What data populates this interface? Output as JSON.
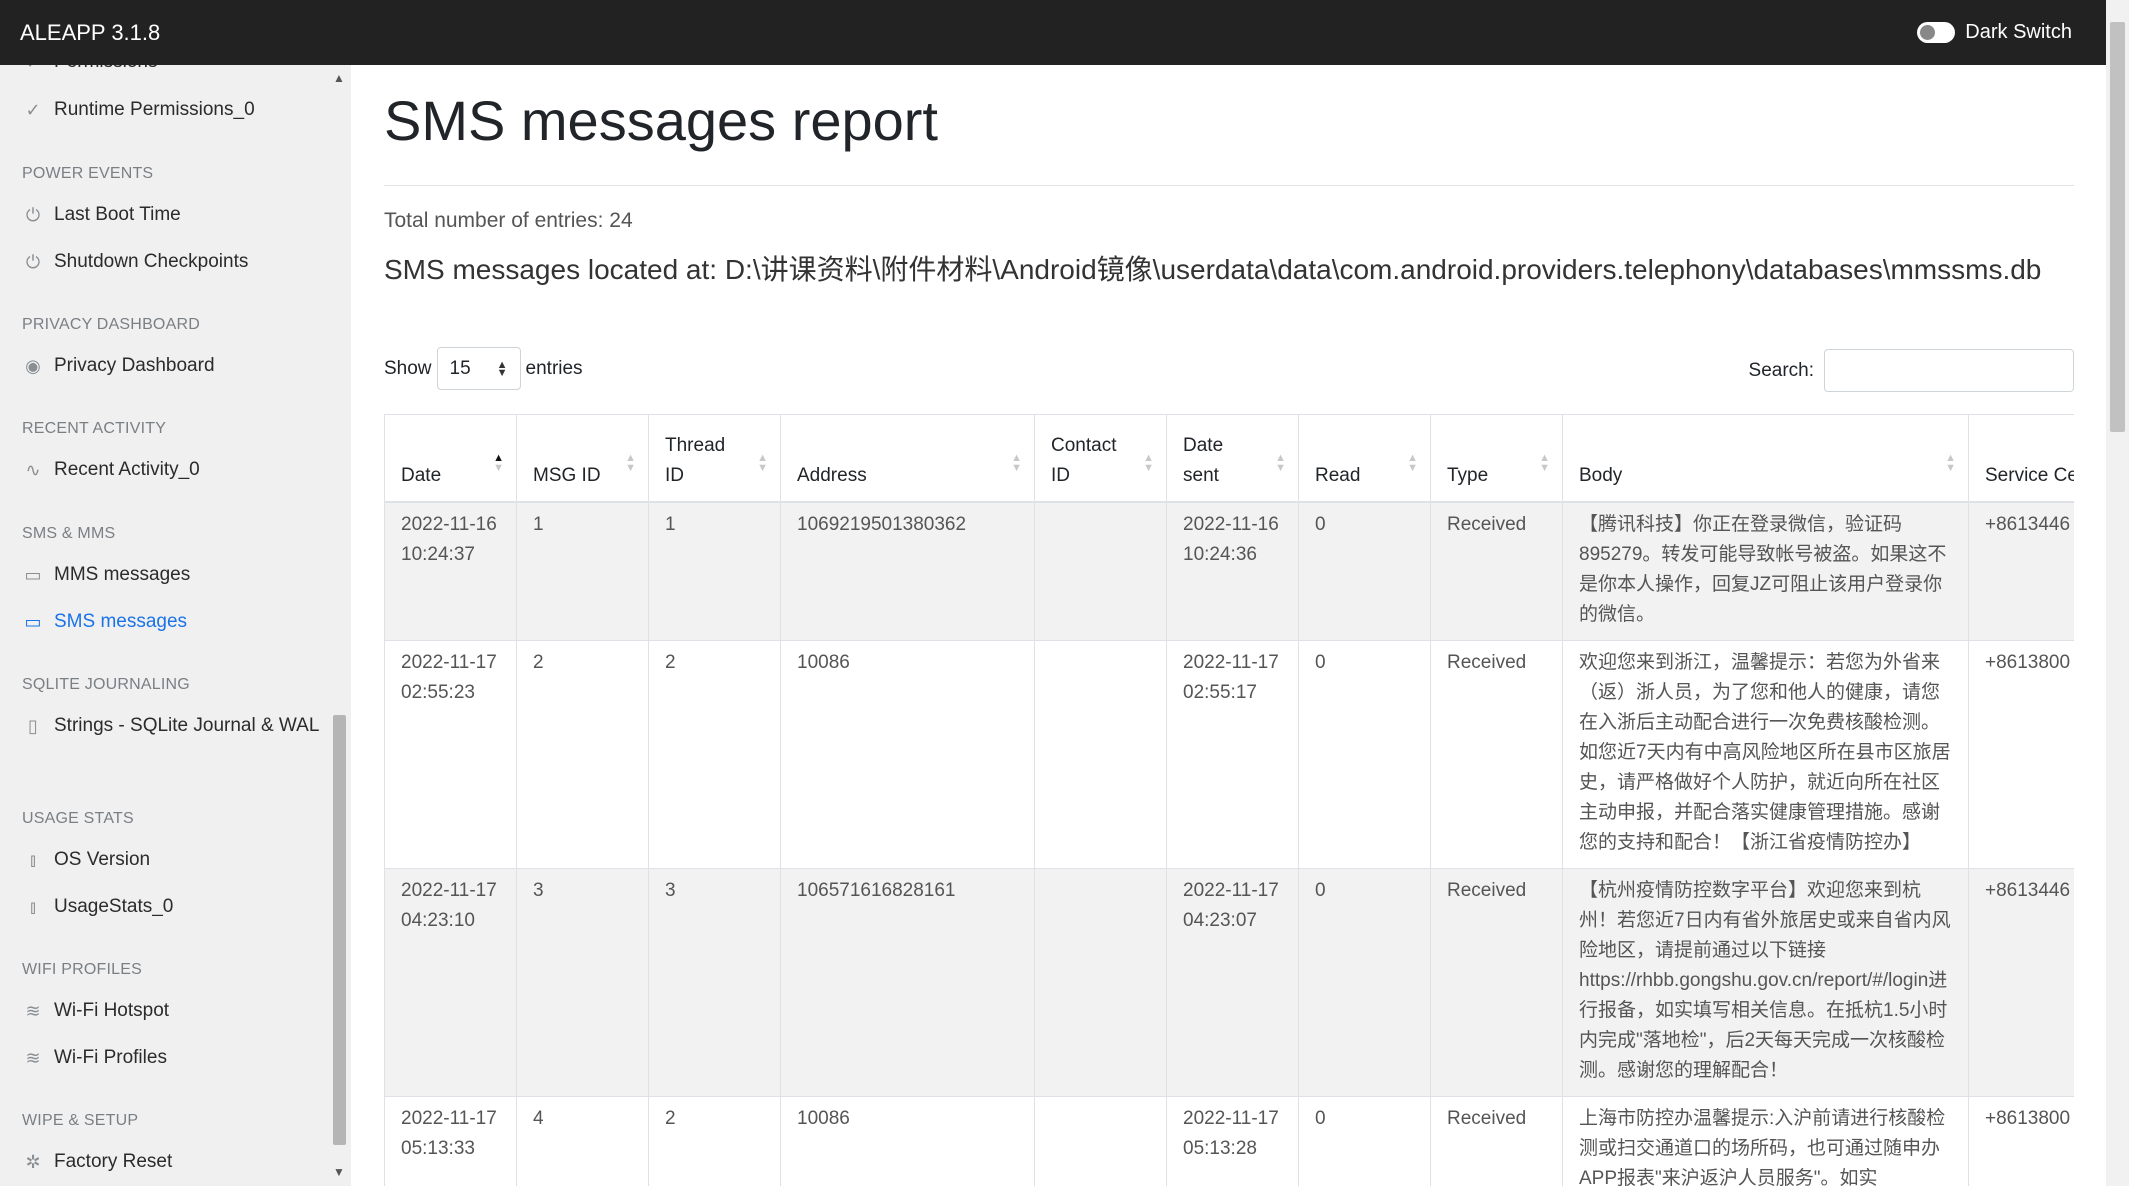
{
  "navbar": {
    "brand": "ALEAPP 3.1.8",
    "switch_label": "Dark Switch"
  },
  "sidebar": {
    "partial_item": "Permissions",
    "items": [
      {
        "heading": null,
        "label": "Runtime Permissions_0",
        "icon": "check-icon"
      },
      {
        "heading": "POWER EVENTS"
      },
      {
        "label": "Last Boot Time",
        "icon": "power-icon"
      },
      {
        "label": "Shutdown Checkpoints",
        "icon": "power-icon"
      },
      {
        "heading": "PRIVACY DASHBOARD"
      },
      {
        "label": "Privacy Dashboard",
        "icon": "eye-icon"
      },
      {
        "heading": "RECENT ACTIVITY"
      },
      {
        "label": "Recent Activity_0",
        "icon": "activity-icon"
      },
      {
        "heading": "SMS & MMS"
      },
      {
        "label": "MMS messages",
        "icon": "message-square-icon"
      },
      {
        "label": "SMS messages",
        "icon": "message-square-icon"
      },
      {
        "heading": "SQLITE JOURNALING"
      },
      {
        "label": "Strings - SQLite Journal & WAL",
        "icon": "book-open-icon"
      },
      {
        "heading": "USAGE STATS"
      },
      {
        "label": "OS Version",
        "icon": "bar-chart-icon"
      },
      {
        "label": "UsageStats_0",
        "icon": "bar-chart-icon"
      },
      {
        "heading": "WIFI PROFILES"
      },
      {
        "label": "Wi-Fi Hotspot",
        "icon": "wifi-icon"
      },
      {
        "label": "Wi-Fi Profiles",
        "icon": "wifi-icon"
      },
      {
        "heading": "WIPE & SETUP"
      },
      {
        "label": "Factory Reset",
        "icon": "loader-icon"
      }
    ]
  },
  "main": {
    "title": "SMS messages report",
    "total": "Total number of entries: 24",
    "located": "SMS messages located at: D:\\讲课资料\\附件材料\\Android镜像\\userdata\\data\\com.android.providers.telephony\\databases\\mmssms.db",
    "show_label": "Show",
    "show_value": "15",
    "entries_label": "entries",
    "search_label": "Search:"
  },
  "table": {
    "columns": [
      "Date",
      "MSG ID",
      "Thread ID",
      "Address",
      "Contact ID",
      "Date sent",
      "Read",
      "Type",
      "Body",
      "Service Ce"
    ],
    "rows": [
      [
        "2022-11-16 10:24:37",
        "1",
        "1",
        "1069219501380362",
        "",
        "2022-11-16 10:24:36",
        "0",
        "Received",
        "【腾讯科技】你正在登录微信，验证码895279。转发可能导致帐号被盗。如果这不是你本人操作，回复JZ可阻止该用户登录你的微信。",
        "+8613446"
      ],
      [
        "2022-11-17 02:55:23",
        "2",
        "2",
        "10086",
        "",
        "2022-11-17 02:55:17",
        "0",
        "Received",
        "欢迎您来到浙江，温馨提示：若您为外省来（返）浙人员，为了您和他人的健康，请您在入浙后主动配合进行一次免费核酸检测。如您近7天内有中高风险地区所在县市区旅居史，请严格做好个人防护，就近向所在社区主动申报，并配合落实健康管理措施。感谢您的支持和配合！【浙江省疫情防控办】",
        "+8613800"
      ],
      [
        "2022-11-17 04:23:10",
        "3",
        "3",
        "106571616828161",
        "",
        "2022-11-17 04:23:07",
        "0",
        "Received",
        "【杭州疫情防控数字平台】欢迎您来到杭州！若您近7日内有省外旅居史或来自省内风险地区，请提前通过以下链接https://rhbb.gongshu.gov.cn/report/#/login进行报备，如实填写相关信息。在抵杭1.5小时内完成\"落地检\"，后2天每天完成一次核酸检测。感谢您的理解配合！",
        "+8613446"
      ],
      [
        "2022-11-17 05:13:33",
        "4",
        "2",
        "10086",
        "",
        "2022-11-17 05:13:28",
        "0",
        "Received",
        "上海市防控办温馨提示:入沪前请进行核酸检测或扫交通道口的场所码，也可通过随申办APP报表\"来沪返沪人员服务\"。如实",
        "+8613800"
      ]
    ]
  }
}
